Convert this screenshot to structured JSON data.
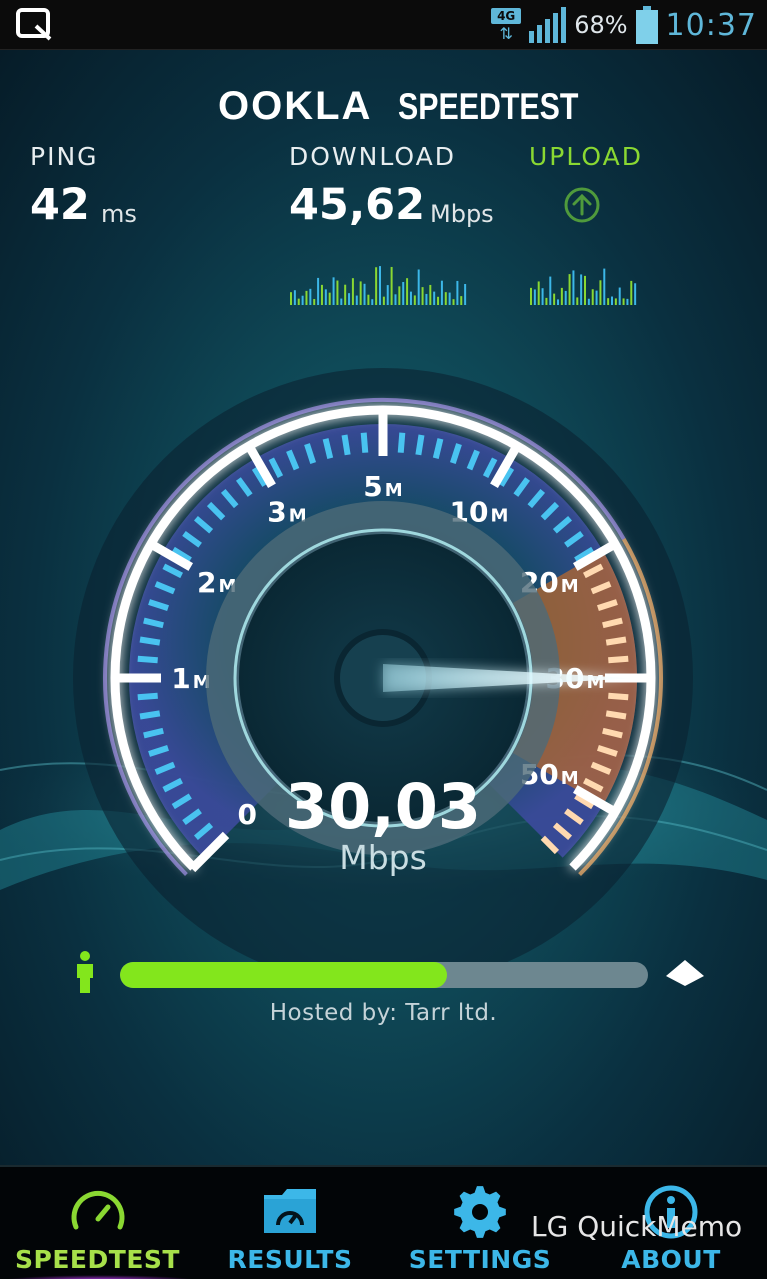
{
  "status_bar": {
    "network_type": "4G",
    "battery_percent": "68%",
    "time": "10:37",
    "battery_level": 0.68,
    "signal_bars": 5
  },
  "brand": {
    "logo": "OOKLA",
    "title": "SPEEDTEST"
  },
  "metrics": {
    "ping": {
      "label": "PING",
      "value": "42",
      "unit": "ms"
    },
    "download": {
      "label": "DOWNLOAD",
      "value": "45,62",
      "unit": "Mbps"
    },
    "upload": {
      "label": "UPLOAD",
      "icon": "arrow-up-circle-icon"
    }
  },
  "gauge": {
    "tick_labels": [
      "0",
      "1M",
      "2M",
      "3M",
      "5M",
      "10M",
      "20M",
      "30M",
      "50M"
    ],
    "current_value": "30,03",
    "current_unit": "Mbps",
    "needle_value_mbps": 30.03
  },
  "progress": {
    "fraction": 0.62,
    "hosted_by": "Hosted by: Tarr ltd."
  },
  "nav": {
    "items": [
      {
        "label": "SPEEDTEST",
        "icon": "speedometer-icon",
        "active": true
      },
      {
        "label": "RESULTS",
        "icon": "folder-gauge-icon",
        "active": false
      },
      {
        "label": "SETTINGS",
        "icon": "gear-icon",
        "active": false
      },
      {
        "label": "ABOUT",
        "icon": "info-icon",
        "active": false
      }
    ]
  },
  "overlay": {
    "watermark": "LG QuickMemo"
  },
  "colors": {
    "accent_green": "#83e61c",
    "accent_blue": "#3cb7e8",
    "upload_green": "#8ad832",
    "active_nav": "#a7e04a"
  }
}
